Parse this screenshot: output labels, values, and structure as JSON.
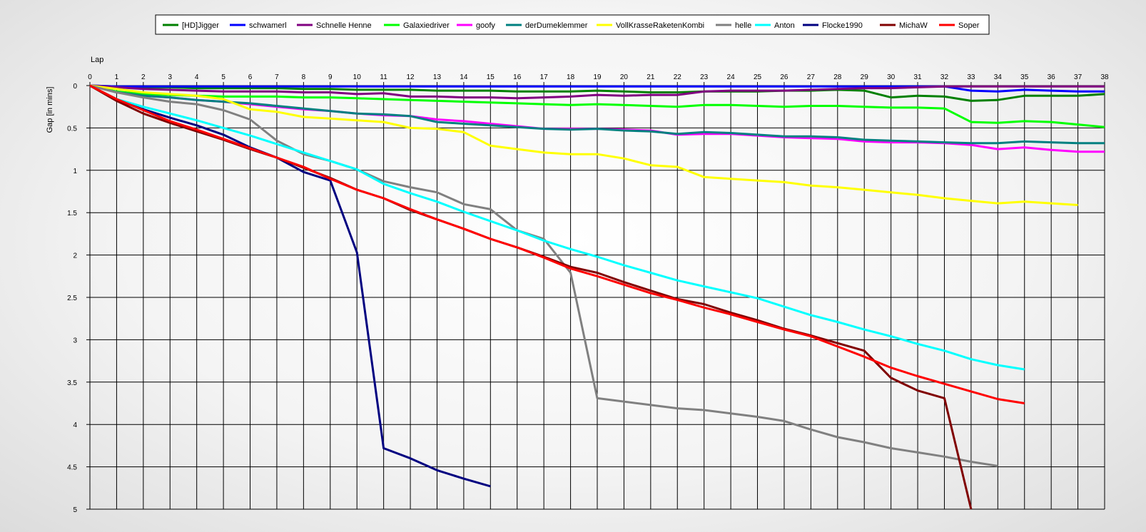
{
  "chart_data": {
    "type": "line",
    "title": "",
    "xlabel": "Lap",
    "ylabel": "Gap [in mins]",
    "xlim": [
      0,
      38
    ],
    "ylim": [
      0,
      5
    ],
    "y_inverted": true,
    "x_axis_position": "top",
    "grid": true,
    "legend_position": "top-center",
    "x_ticks": [
      "0",
      "1",
      "2",
      "3",
      "4",
      "5",
      "6",
      "7",
      "8",
      "9",
      "10",
      "11",
      "12",
      "13",
      "14",
      "15",
      "16",
      "17",
      "18",
      "19",
      "20",
      "21",
      "22",
      "23",
      "24",
      "25",
      "26",
      "27",
      "28",
      "29",
      "30",
      "31",
      "32",
      "33",
      "34",
      "35",
      "36",
      "37",
      "38"
    ],
    "y_ticks": [
      "0",
      "0.5",
      "1",
      "1.5",
      "2",
      "2.5",
      "3",
      "3.5",
      "4",
      "4.5",
      "5"
    ],
    "series": [
      {
        "name": "[HD]Jigger",
        "color": "#008000",
        "x": [
          0,
          1,
          2,
          3,
          4,
          5,
          6,
          7,
          8,
          9,
          10,
          11,
          12,
          13,
          14,
          15,
          16,
          17,
          18,
          19,
          20,
          21,
          22,
          23,
          24,
          25,
          26,
          27,
          28,
          29,
          30,
          31,
          32,
          33,
          34,
          35,
          36,
          37,
          38
        ],
        "y": [
          0,
          0.01,
          0.02,
          0.02,
          0.03,
          0.03,
          0.03,
          0.03,
          0.04,
          0.04,
          0.05,
          0.05,
          0.05,
          0.06,
          0.06,
          0.06,
          0.07,
          0.07,
          0.07,
          0.06,
          0.07,
          0.08,
          0.08,
          0.07,
          0.07,
          0.07,
          0.06,
          0.06,
          0.05,
          0.06,
          0.14,
          0.12,
          0.13,
          0.18,
          0.17,
          0.12,
          0.12,
          0.12,
          0.1
        ]
      },
      {
        "name": "schwamerl",
        "color": "#0000ff",
        "x": [
          0,
          1,
          2,
          3,
          4,
          5,
          6,
          7,
          8,
          9,
          10,
          11,
          12,
          13,
          14,
          15,
          16,
          17,
          18,
          19,
          20,
          21,
          22,
          23,
          24,
          25,
          26,
          27,
          28,
          29,
          30,
          31,
          32,
          33,
          34,
          35,
          36,
          37,
          38
        ],
        "y": [
          0,
          0.01,
          0.01,
          0.01,
          0.01,
          0.01,
          0.01,
          0.01,
          0.01,
          0.01,
          0.01,
          0.01,
          0.01,
          0.01,
          0.01,
          0.01,
          0.01,
          0.01,
          0.01,
          0.01,
          0.01,
          0.01,
          0.01,
          0.01,
          0.01,
          0.01,
          0.01,
          0.01,
          0.01,
          0.01,
          0.01,
          0.01,
          0.01,
          0.06,
          0.07,
          0.05,
          0.06,
          0.07,
          0.07
        ]
      },
      {
        "name": "Schnelle Henne",
        "color": "#800080",
        "x": [
          0,
          1,
          2,
          3,
          4,
          5,
          6,
          7,
          8,
          9,
          10,
          11,
          12,
          13,
          14,
          15,
          16,
          17,
          18,
          19,
          20,
          21,
          22,
          23,
          24,
          25,
          26,
          27,
          28,
          29,
          30,
          31,
          32,
          33,
          34,
          35,
          36,
          37,
          38
        ],
        "y": [
          0,
          0.02,
          0.04,
          0.05,
          0.06,
          0.07,
          0.07,
          0.07,
          0.08,
          0.08,
          0.1,
          0.09,
          0.13,
          0.13,
          0.14,
          0.14,
          0.15,
          0.14,
          0.13,
          0.11,
          0.12,
          0.11,
          0.11,
          0.07,
          0.06,
          0.06,
          0.06,
          0.05,
          0.04,
          0.03,
          0.03,
          0.02,
          0.01,
          0.01,
          0.01,
          0.01,
          0.01,
          0.01,
          0.01
        ]
      },
      {
        "name": "Galaxiedriver",
        "color": "#00ff00",
        "x": [
          0,
          1,
          2,
          3,
          4,
          5,
          6,
          7,
          8,
          9,
          10,
          11,
          12,
          13,
          14,
          15,
          16,
          17,
          18,
          19,
          20,
          21,
          22,
          23,
          24,
          25,
          26,
          27,
          28,
          29,
          30,
          31,
          32,
          33,
          34,
          35,
          36,
          37,
          38
        ],
        "y": [
          0,
          0.07,
          0.1,
          0.11,
          0.12,
          0.13,
          0.13,
          0.13,
          0.14,
          0.14,
          0.15,
          0.16,
          0.17,
          0.18,
          0.19,
          0.2,
          0.21,
          0.22,
          0.23,
          0.22,
          0.23,
          0.24,
          0.25,
          0.23,
          0.23,
          0.24,
          0.25,
          0.24,
          0.24,
          0.25,
          0.26,
          0.26,
          0.27,
          0.43,
          0.44,
          0.42,
          0.43,
          0.46,
          0.49
        ]
      },
      {
        "name": "goofy",
        "color": "#ff00ff",
        "x": [
          0,
          1,
          2,
          3,
          4,
          5,
          6,
          7,
          8,
          9,
          10,
          11,
          12,
          13,
          14,
          15,
          16,
          17,
          18,
          19,
          20,
          21,
          22,
          23,
          24,
          25,
          26,
          27,
          28,
          29,
          30,
          31,
          32,
          33,
          34,
          35,
          36,
          37,
          38
        ],
        "y": [
          0,
          0.08,
          0.12,
          0.14,
          0.17,
          0.19,
          0.22,
          0.25,
          0.28,
          0.3,
          0.33,
          0.35,
          0.36,
          0.4,
          0.42,
          0.45,
          0.48,
          0.51,
          0.51,
          0.51,
          0.52,
          0.53,
          0.58,
          0.57,
          0.57,
          0.59,
          0.61,
          0.62,
          0.63,
          0.66,
          0.67,
          0.67,
          0.68,
          0.7,
          0.75,
          0.73,
          0.76,
          0.78,
          0.78
        ]
      },
      {
        "name": "derDumeklemmer",
        "color": "#008080",
        "x": [
          0,
          1,
          2,
          3,
          4,
          5,
          6,
          7,
          8,
          9,
          10,
          11,
          12,
          13,
          14,
          15,
          16,
          17,
          18,
          19,
          20,
          21,
          22,
          23,
          24,
          25,
          26,
          27,
          28,
          29,
          30,
          31,
          32,
          33,
          34,
          35,
          36,
          37,
          38
        ],
        "y": [
          0,
          0.08,
          0.12,
          0.14,
          0.17,
          0.19,
          0.21,
          0.24,
          0.27,
          0.3,
          0.33,
          0.34,
          0.36,
          0.43,
          0.45,
          0.47,
          0.49,
          0.51,
          0.52,
          0.51,
          0.53,
          0.54,
          0.57,
          0.55,
          0.56,
          0.58,
          0.6,
          0.6,
          0.61,
          0.64,
          0.65,
          0.66,
          0.67,
          0.68,
          0.68,
          0.66,
          0.67,
          0.68,
          0.68
        ]
      },
      {
        "name": "VollKrasseRaketenKombi",
        "color": "#ffff00",
        "x": [
          0,
          1,
          2,
          3,
          4,
          5,
          6,
          7,
          8,
          9,
          10,
          11,
          12,
          13,
          14,
          15,
          16,
          17,
          18,
          19,
          20,
          21,
          22,
          23,
          24,
          25,
          26,
          27,
          28,
          29,
          30,
          31,
          32,
          33,
          34,
          35,
          36,
          37
        ],
        "y": [
          0,
          0.04,
          0.08,
          0.1,
          0.12,
          0.16,
          0.28,
          0.31,
          0.37,
          0.39,
          0.41,
          0.43,
          0.5,
          0.51,
          0.55,
          0.71,
          0.75,
          0.79,
          0.81,
          0.81,
          0.86,
          0.94,
          0.96,
          1.08,
          1.1,
          1.12,
          1.14,
          1.18,
          1.2,
          1.23,
          1.26,
          1.29,
          1.33,
          1.36,
          1.39,
          1.37,
          1.39,
          1.41
        ]
      },
      {
        "name": "helle",
        "color": "#808080",
        "x": [
          0,
          1,
          2,
          3,
          4,
          5,
          6,
          7,
          8,
          9,
          10,
          11,
          12,
          13,
          14,
          15,
          16,
          17,
          18,
          19,
          20,
          21,
          22,
          23,
          24,
          25,
          26,
          27,
          28,
          29,
          30,
          31,
          32,
          33,
          34
        ],
        "y": [
          0,
          0.08,
          0.14,
          0.19,
          0.22,
          0.29,
          0.4,
          0.65,
          0.81,
          0.89,
          0.99,
          1.13,
          1.2,
          1.26,
          1.4,
          1.46,
          1.71,
          1.81,
          2.21,
          3.69,
          3.73,
          3.77,
          3.81,
          3.83,
          3.87,
          3.91,
          3.96,
          4.06,
          4.15,
          4.21,
          4.28,
          4.33,
          4.38,
          4.44,
          4.49
        ]
      },
      {
        "name": "Anton",
        "color": "#00ffff",
        "x": [
          0,
          1,
          2,
          3,
          4,
          5,
          6,
          7,
          8,
          9,
          10,
          11,
          12,
          13,
          14,
          15,
          16,
          17,
          18,
          19,
          20,
          21,
          22,
          23,
          24,
          25,
          26,
          27,
          28,
          29,
          30,
          31,
          32,
          33,
          34,
          35
        ],
        "y": [
          0,
          0.16,
          0.25,
          0.33,
          0.41,
          0.5,
          0.59,
          0.69,
          0.79,
          0.89,
          0.99,
          1.16,
          1.27,
          1.37,
          1.49,
          1.6,
          1.71,
          1.83,
          1.93,
          2.02,
          2.12,
          2.21,
          2.3,
          2.37,
          2.44,
          2.51,
          2.61,
          2.71,
          2.79,
          2.88,
          2.96,
          3.05,
          3.13,
          3.23,
          3.3,
          3.35
        ]
      },
      {
        "name": "Flocke1990",
        "color": "#000080",
        "x": [
          0,
          1,
          2,
          3,
          4,
          5,
          6,
          7,
          8,
          9,
          10,
          11,
          12,
          13,
          14,
          15
        ],
        "y": [
          0,
          0.17,
          0.28,
          0.38,
          0.47,
          0.58,
          0.73,
          0.85,
          1.02,
          1.12,
          1.97,
          4.28,
          4.4,
          4.54,
          4.64,
          4.73
        ]
      },
      {
        "name": "MichaW",
        "color": "#800000",
        "x": [
          0,
          1,
          2,
          3,
          4,
          5,
          6,
          7,
          8,
          9,
          10,
          11,
          12,
          13,
          14,
          15,
          16,
          17,
          18,
          19,
          20,
          21,
          22,
          23,
          24,
          25,
          26,
          27,
          28,
          29,
          30,
          31,
          32,
          33
        ],
        "y": [
          0,
          0.18,
          0.33,
          0.44,
          0.54,
          0.64,
          0.75,
          0.85,
          0.97,
          1.09,
          1.23,
          1.33,
          1.47,
          1.58,
          1.69,
          1.81,
          1.91,
          2.02,
          2.14,
          2.21,
          2.32,
          2.42,
          2.52,
          2.58,
          2.68,
          2.77,
          2.87,
          2.95,
          3.04,
          3.13,
          3.45,
          3.6,
          3.69,
          5.0
        ]
      },
      {
        "name": "Soper",
        "color": "#ff0000",
        "x": [
          0,
          1,
          2,
          3,
          4,
          5,
          6,
          7,
          8,
          9,
          10,
          11,
          12,
          13,
          14,
          15,
          16,
          17,
          18,
          19,
          20,
          21,
          22,
          23,
          24,
          25,
          26,
          27,
          28,
          29,
          30,
          31,
          32,
          33,
          34,
          35
        ],
        "y": [
          0,
          0.16,
          0.29,
          0.42,
          0.52,
          0.63,
          0.74,
          0.85,
          0.96,
          1.1,
          1.23,
          1.33,
          1.46,
          1.58,
          1.69,
          1.81,
          1.91,
          2.03,
          2.16,
          2.25,
          2.35,
          2.45,
          2.53,
          2.62,
          2.7,
          2.79,
          2.88,
          2.96,
          3.08,
          3.2,
          3.33,
          3.43,
          3.52,
          3.61,
          3.7,
          3.75
        ]
      }
    ]
  }
}
